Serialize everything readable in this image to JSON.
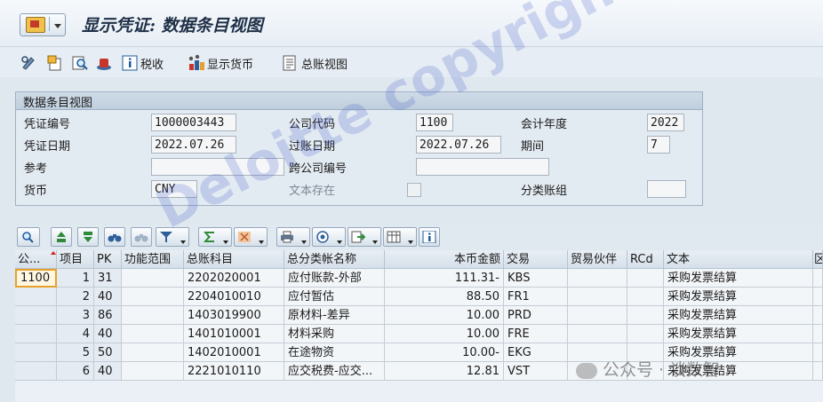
{
  "title": "显示凭证: 数据条目视图",
  "toolbar": {
    "items": [
      {
        "name": "display-change-icon"
      },
      {
        "name": "other-document-icon"
      },
      {
        "name": "search-icon"
      },
      {
        "name": "hat-icon"
      },
      {
        "name": "info-icon",
        "label": "税收"
      },
      {
        "name": "currency-icon",
        "label": "显示货币"
      },
      {
        "name": "ledger-icon",
        "label": "总账视图"
      }
    ]
  },
  "header": {
    "group_title": "数据条目视图",
    "doc_no_label": "凭证编号",
    "doc_no": "1000003443",
    "company_label": "公司代码",
    "company": "1100",
    "fiscal_year_label": "会计年度",
    "fiscal_year": "2022",
    "doc_date_label": "凭证日期",
    "doc_date": "2022.07.26",
    "posting_date_label": "过账日期",
    "posting_date": "2022.07.26",
    "period_label": "期间",
    "period": "7",
    "reference_label": "参考",
    "reference": "",
    "cross_company_label": "跨公司编号",
    "cross_company": "",
    "currency_label": "货币",
    "currency": "CNY",
    "text_exists_label": "文本存在",
    "ledger_group_label": "分类账组",
    "ledger_group": ""
  },
  "grid": {
    "columns": [
      "公...",
      "项目",
      "PK",
      "功能范围",
      "总账科目",
      "总分类帐名称",
      "本币金额",
      "交易",
      "贸易伙伴",
      "RCd",
      "文本",
      "区"
    ],
    "rows": [
      {
        "co": "1100",
        "item": "1",
        "pk": "31",
        "func": "",
        "gl": "2202020001",
        "name": "应付账款-外部",
        "amount": "111.31-",
        "trans": "KBS",
        "partner": "",
        "rcd": "",
        "text": "采购发票结算"
      },
      {
        "co": "",
        "item": "2",
        "pk": "40",
        "func": "",
        "gl": "2204010010",
        "name": "应付暂估",
        "amount": "88.50",
        "trans": "FR1",
        "partner": "",
        "rcd": "",
        "text": "采购发票结算"
      },
      {
        "co": "",
        "item": "3",
        "pk": "86",
        "func": "",
        "gl": "1403019900",
        "name": "原材料-差异",
        "amount": "10.00",
        "trans": "PRD",
        "partner": "",
        "rcd": "",
        "text": "采购发票结算"
      },
      {
        "co": "",
        "item": "4",
        "pk": "40",
        "func": "",
        "gl": "1401010001",
        "name": "材料采购",
        "amount": "10.00",
        "trans": "FRE",
        "partner": "",
        "rcd": "",
        "text": "采购发票结算"
      },
      {
        "co": "",
        "item": "5",
        "pk": "50",
        "func": "",
        "gl": "1402010001",
        "name": "在途物资",
        "amount": "10.00-",
        "trans": "EKG",
        "partner": "",
        "rcd": "",
        "text": "采购发票结算"
      },
      {
        "co": "",
        "item": "6",
        "pk": "40",
        "func": "",
        "gl": "2221010110",
        "name": "应交税费-应交...",
        "amount": "12.81",
        "trans": "VST",
        "partner": "",
        "rcd": "",
        "text": "采购发票结算"
      }
    ]
  },
  "watermark": {
    "text": "Deloitte copyright",
    "wechat": "公众号 · 谈数智"
  }
}
